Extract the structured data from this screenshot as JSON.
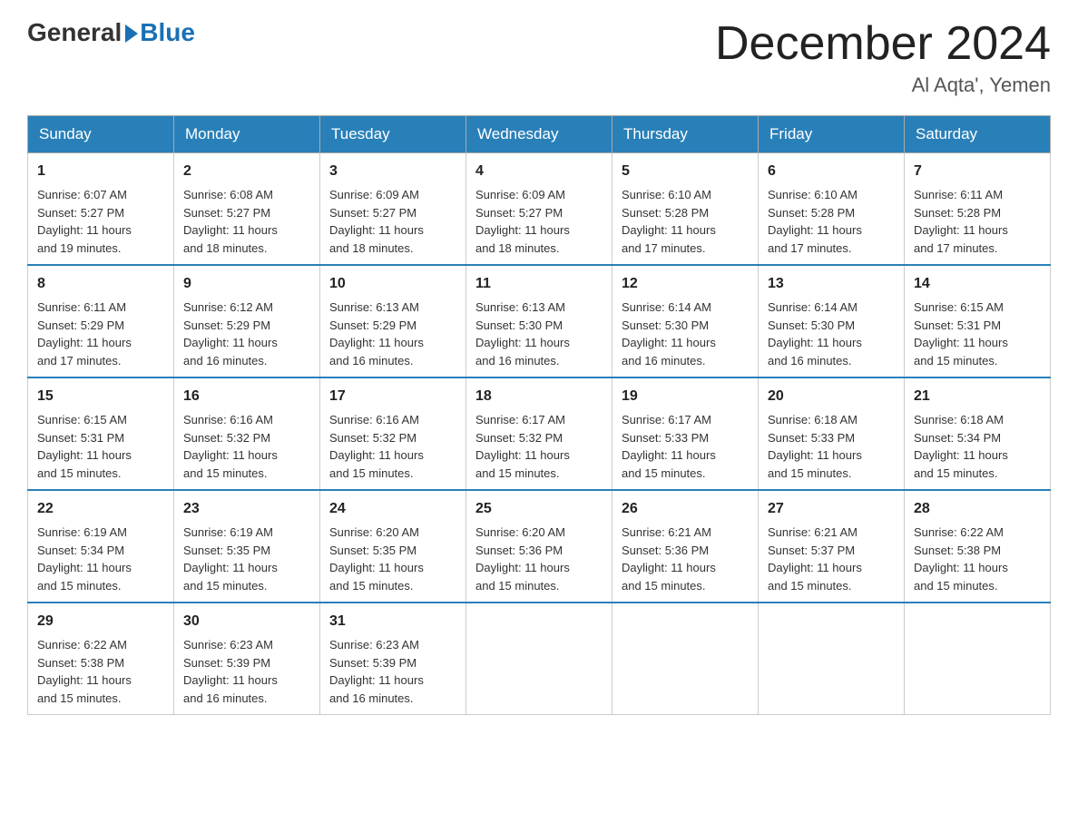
{
  "header": {
    "logo_general": "General",
    "logo_blue": "Blue",
    "month_title": "December 2024",
    "location": "Al Aqta', Yemen"
  },
  "days_of_week": [
    "Sunday",
    "Monday",
    "Tuesday",
    "Wednesday",
    "Thursday",
    "Friday",
    "Saturday"
  ],
  "weeks": [
    [
      {
        "day": "1",
        "info": "Sunrise: 6:07 AM\nSunset: 5:27 PM\nDaylight: 11 hours\nand 19 minutes."
      },
      {
        "day": "2",
        "info": "Sunrise: 6:08 AM\nSunset: 5:27 PM\nDaylight: 11 hours\nand 18 minutes."
      },
      {
        "day": "3",
        "info": "Sunrise: 6:09 AM\nSunset: 5:27 PM\nDaylight: 11 hours\nand 18 minutes."
      },
      {
        "day": "4",
        "info": "Sunrise: 6:09 AM\nSunset: 5:27 PM\nDaylight: 11 hours\nand 18 minutes."
      },
      {
        "day": "5",
        "info": "Sunrise: 6:10 AM\nSunset: 5:28 PM\nDaylight: 11 hours\nand 17 minutes."
      },
      {
        "day": "6",
        "info": "Sunrise: 6:10 AM\nSunset: 5:28 PM\nDaylight: 11 hours\nand 17 minutes."
      },
      {
        "day": "7",
        "info": "Sunrise: 6:11 AM\nSunset: 5:28 PM\nDaylight: 11 hours\nand 17 minutes."
      }
    ],
    [
      {
        "day": "8",
        "info": "Sunrise: 6:11 AM\nSunset: 5:29 PM\nDaylight: 11 hours\nand 17 minutes."
      },
      {
        "day": "9",
        "info": "Sunrise: 6:12 AM\nSunset: 5:29 PM\nDaylight: 11 hours\nand 16 minutes."
      },
      {
        "day": "10",
        "info": "Sunrise: 6:13 AM\nSunset: 5:29 PM\nDaylight: 11 hours\nand 16 minutes."
      },
      {
        "day": "11",
        "info": "Sunrise: 6:13 AM\nSunset: 5:30 PM\nDaylight: 11 hours\nand 16 minutes."
      },
      {
        "day": "12",
        "info": "Sunrise: 6:14 AM\nSunset: 5:30 PM\nDaylight: 11 hours\nand 16 minutes."
      },
      {
        "day": "13",
        "info": "Sunrise: 6:14 AM\nSunset: 5:30 PM\nDaylight: 11 hours\nand 16 minutes."
      },
      {
        "day": "14",
        "info": "Sunrise: 6:15 AM\nSunset: 5:31 PM\nDaylight: 11 hours\nand 15 minutes."
      }
    ],
    [
      {
        "day": "15",
        "info": "Sunrise: 6:15 AM\nSunset: 5:31 PM\nDaylight: 11 hours\nand 15 minutes."
      },
      {
        "day": "16",
        "info": "Sunrise: 6:16 AM\nSunset: 5:32 PM\nDaylight: 11 hours\nand 15 minutes."
      },
      {
        "day": "17",
        "info": "Sunrise: 6:16 AM\nSunset: 5:32 PM\nDaylight: 11 hours\nand 15 minutes."
      },
      {
        "day": "18",
        "info": "Sunrise: 6:17 AM\nSunset: 5:32 PM\nDaylight: 11 hours\nand 15 minutes."
      },
      {
        "day": "19",
        "info": "Sunrise: 6:17 AM\nSunset: 5:33 PM\nDaylight: 11 hours\nand 15 minutes."
      },
      {
        "day": "20",
        "info": "Sunrise: 6:18 AM\nSunset: 5:33 PM\nDaylight: 11 hours\nand 15 minutes."
      },
      {
        "day": "21",
        "info": "Sunrise: 6:18 AM\nSunset: 5:34 PM\nDaylight: 11 hours\nand 15 minutes."
      }
    ],
    [
      {
        "day": "22",
        "info": "Sunrise: 6:19 AM\nSunset: 5:34 PM\nDaylight: 11 hours\nand 15 minutes."
      },
      {
        "day": "23",
        "info": "Sunrise: 6:19 AM\nSunset: 5:35 PM\nDaylight: 11 hours\nand 15 minutes."
      },
      {
        "day": "24",
        "info": "Sunrise: 6:20 AM\nSunset: 5:35 PM\nDaylight: 11 hours\nand 15 minutes."
      },
      {
        "day": "25",
        "info": "Sunrise: 6:20 AM\nSunset: 5:36 PM\nDaylight: 11 hours\nand 15 minutes."
      },
      {
        "day": "26",
        "info": "Sunrise: 6:21 AM\nSunset: 5:36 PM\nDaylight: 11 hours\nand 15 minutes."
      },
      {
        "day": "27",
        "info": "Sunrise: 6:21 AM\nSunset: 5:37 PM\nDaylight: 11 hours\nand 15 minutes."
      },
      {
        "day": "28",
        "info": "Sunrise: 6:22 AM\nSunset: 5:38 PM\nDaylight: 11 hours\nand 15 minutes."
      }
    ],
    [
      {
        "day": "29",
        "info": "Sunrise: 6:22 AM\nSunset: 5:38 PM\nDaylight: 11 hours\nand 15 minutes."
      },
      {
        "day": "30",
        "info": "Sunrise: 6:23 AM\nSunset: 5:39 PM\nDaylight: 11 hours\nand 16 minutes."
      },
      {
        "day": "31",
        "info": "Sunrise: 6:23 AM\nSunset: 5:39 PM\nDaylight: 11 hours\nand 16 minutes."
      },
      {
        "day": "",
        "info": ""
      },
      {
        "day": "",
        "info": ""
      },
      {
        "day": "",
        "info": ""
      },
      {
        "day": "",
        "info": ""
      }
    ]
  ]
}
